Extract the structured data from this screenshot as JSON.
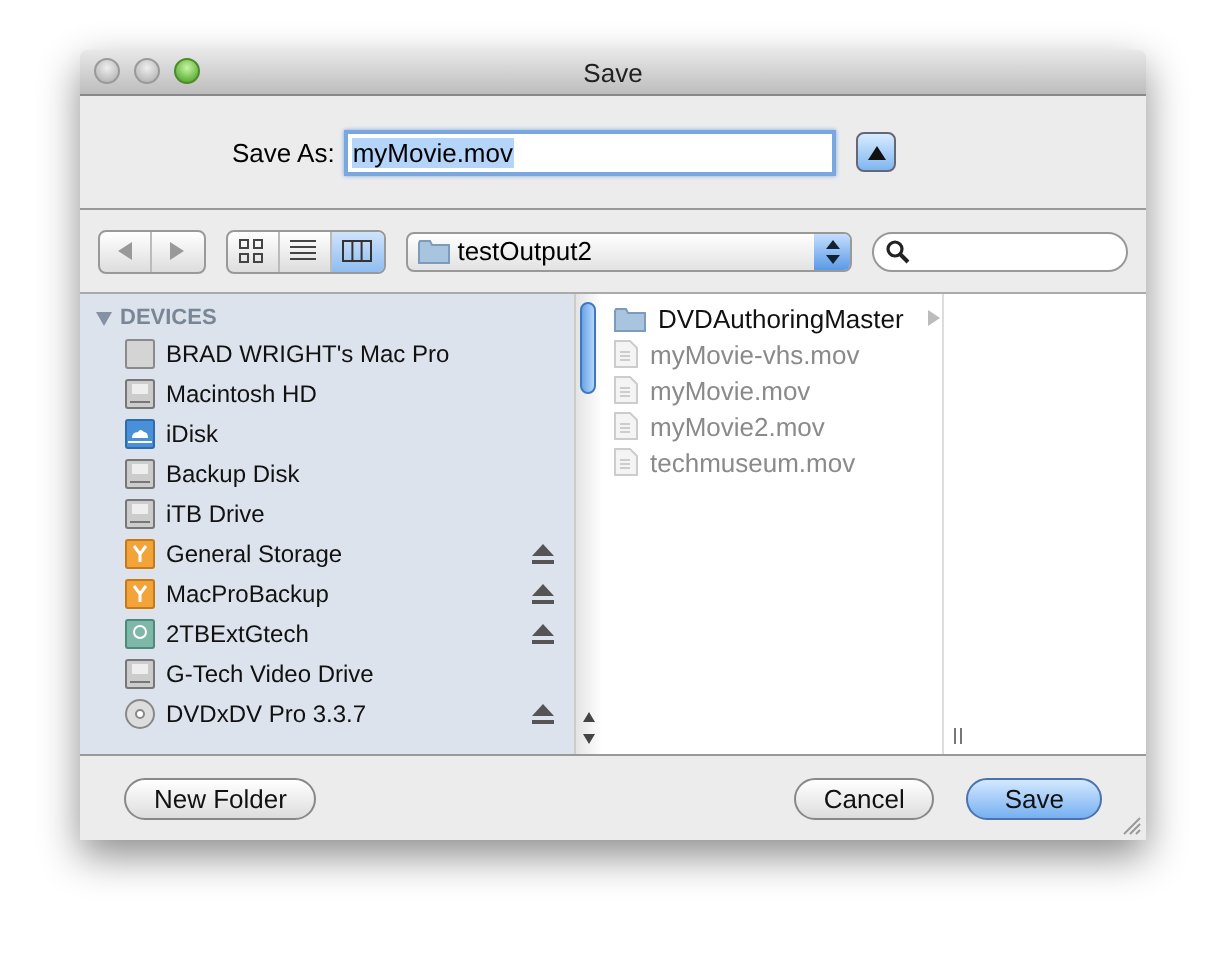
{
  "window": {
    "title": "Save"
  },
  "save_as": {
    "label": "Save As:",
    "value": "myMovie.mov",
    "expanded": true
  },
  "toolbar": {
    "view_modes": [
      {
        "kind": "icons",
        "selected": false
      },
      {
        "kind": "list",
        "selected": false
      },
      {
        "kind": "columns",
        "selected": true
      }
    ],
    "location": "testOutput2"
  },
  "sidebar": {
    "section": {
      "title": "DEVICES",
      "expanded": true
    },
    "items": [
      {
        "name": "BRAD WRIGHT's Mac Pro",
        "kind": "computer",
        "ejectable": false
      },
      {
        "name": "Macintosh HD",
        "kind": "drive",
        "ejectable": false
      },
      {
        "name": "iDisk",
        "kind": "idisk",
        "ejectable": false
      },
      {
        "name": "Backup Disk",
        "kind": "drive",
        "ejectable": false
      },
      {
        "name": "iTB Drive",
        "kind": "drive",
        "ejectable": false
      },
      {
        "name": "General Storage",
        "kind": "external",
        "ejectable": true
      },
      {
        "name": "MacProBackup",
        "kind": "external",
        "ejectable": true
      },
      {
        "name": "2TBExtGtech",
        "kind": "backup",
        "ejectable": true
      },
      {
        "name": "G-Tech Video Drive",
        "kind": "drive",
        "ejectable": false
      },
      {
        "name": "DVDxDV Pro 3.3.7",
        "kind": "optical",
        "ejectable": true
      }
    ]
  },
  "files": [
    {
      "name": "DVDAuthoringMaster",
      "kind": "folder",
      "disabled": false
    },
    {
      "name": "myMovie-vhs.mov",
      "kind": "file",
      "disabled": true
    },
    {
      "name": "myMovie.mov",
      "kind": "file",
      "disabled": true
    },
    {
      "name": "myMovie2.mov",
      "kind": "file",
      "disabled": true
    },
    {
      "name": "techmuseum.mov",
      "kind": "file",
      "disabled": true
    }
  ],
  "buttons": {
    "left": [
      {
        "label": "New Folder",
        "default": false
      }
    ],
    "right": [
      {
        "label": "Cancel",
        "default": false
      },
      {
        "label": "Save",
        "default": true
      }
    ]
  }
}
